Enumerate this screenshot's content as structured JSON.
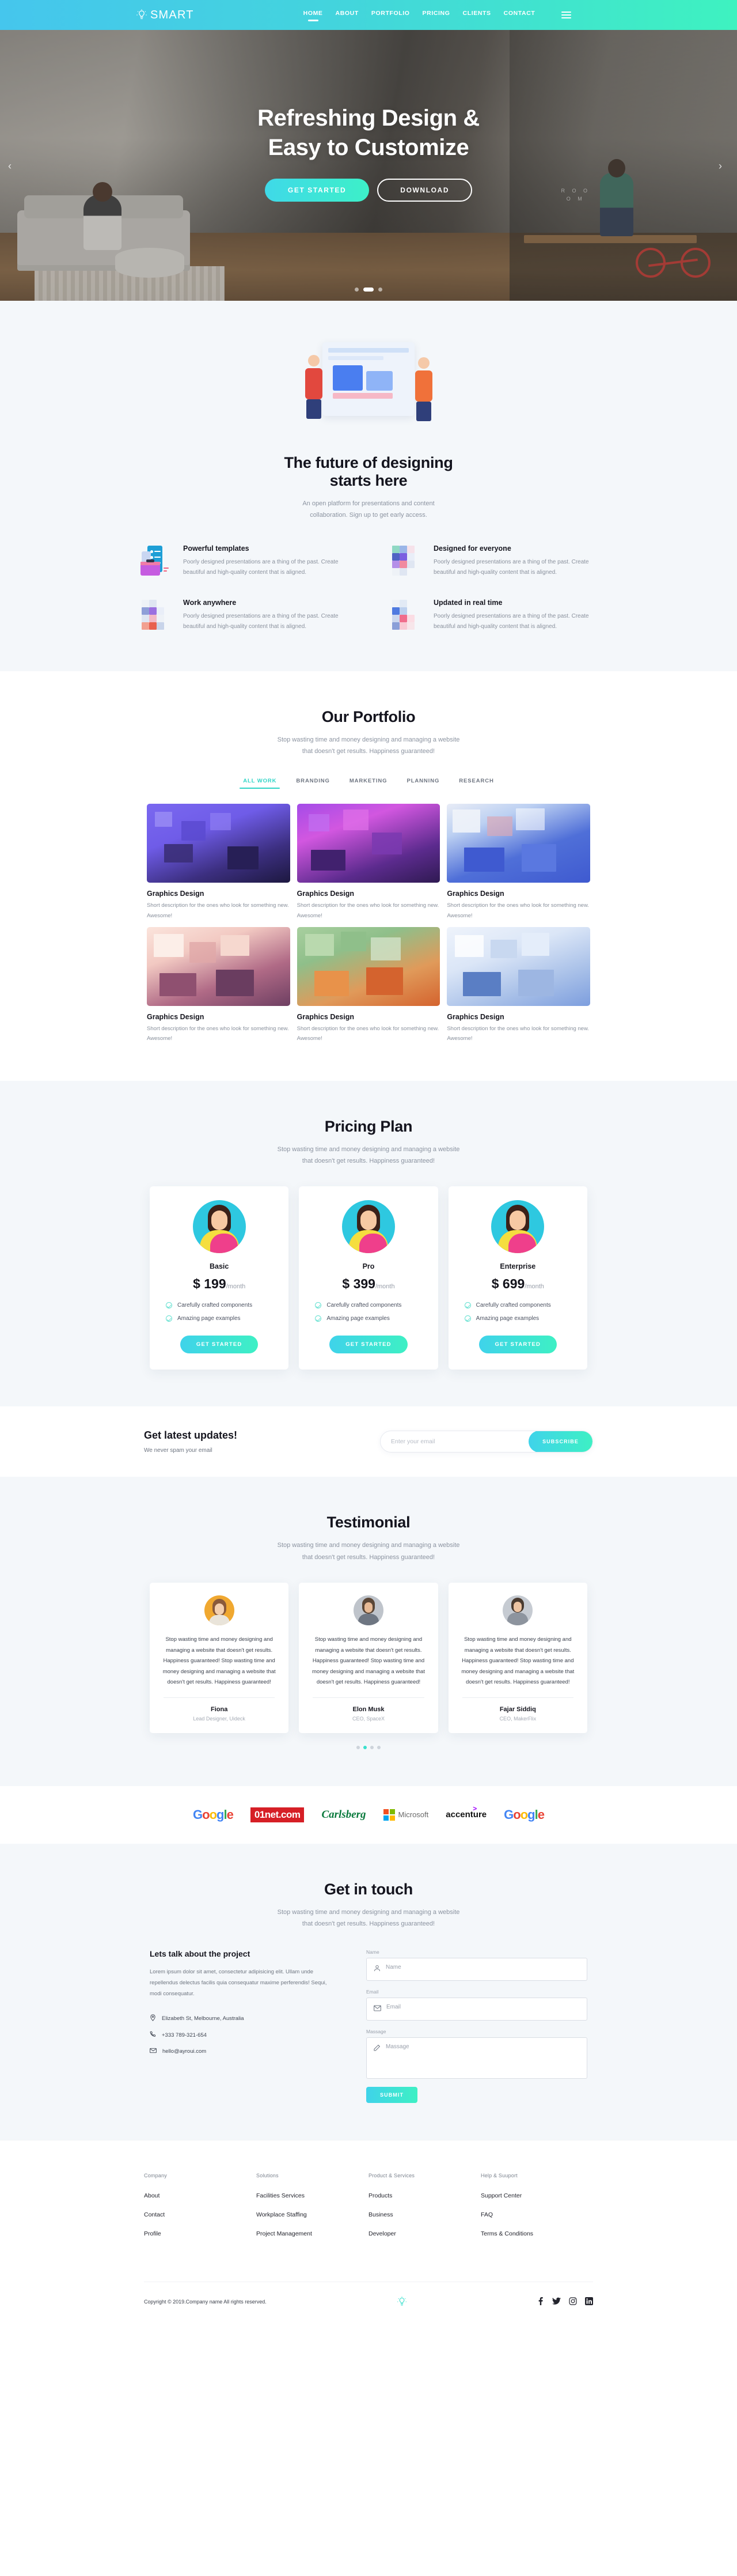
{
  "nav": {
    "brand": "SMART",
    "brand_icon": "lightbulb-icon",
    "items": [
      {
        "label": "HOME",
        "active": true
      },
      {
        "label": "ABOUT",
        "active": false
      },
      {
        "label": "PORTFOLIO",
        "active": false
      },
      {
        "label": "PRICING",
        "active": false
      },
      {
        "label": "CLIENTS",
        "active": false
      },
      {
        "label": "CONTACT",
        "active": false
      }
    ],
    "menu_icon": "hamburger-menu-icon"
  },
  "hero": {
    "title_line1": "Refreshing Design &",
    "title_line2": "Easy to Customize",
    "primary_button": "GET STARTED",
    "secondary_button": "DOWNLOAD",
    "room_label_line1": "R  O  O",
    "room_label_line2": "O     M",
    "slider_dots": 3,
    "active_dot": 1
  },
  "future": {
    "title_line1": "The future of designing",
    "title_line2": "starts here",
    "subtitle_line1": "An open platform for presentations and content",
    "subtitle_line2": "collaboration. Sign up to get early access.",
    "features": [
      {
        "title": "Powerful templates",
        "desc": "Poorly designed presentations are a thing of the past. Create beautiful and high-quality content that is aligned.",
        "icon": "document-briefcase-icon"
      },
      {
        "title": "Designed for everyone",
        "desc": "Poorly designed presentations are a thing of the past. Create beautiful and high-quality content that is aligned.",
        "icon": "pixel-blocks-icon"
      },
      {
        "title": "Work anywhere",
        "desc": "Poorly designed presentations are a thing of the past. Create beautiful and high-quality content that is aligned.",
        "icon": "pixel-blocks-icon"
      },
      {
        "title": "Updated in real time",
        "desc": "Poorly designed presentations are a thing of the past. Create beautiful and high-quality content that is aligned.",
        "icon": "pixel-blocks-icon"
      }
    ]
  },
  "portfolio": {
    "title": "Our Portfolio",
    "subtitle_line1": "Stop wasting time and money designing and managing a website",
    "subtitle_line2": "that doesn't get results. Happiness guaranteed!",
    "tabs": [
      {
        "label": "ALL WORK",
        "active": true
      },
      {
        "label": "BRANDING",
        "active": false
      },
      {
        "label": "MARKETING",
        "active": false
      },
      {
        "label": "PLANNING",
        "active": false
      },
      {
        "label": "RESEARCH",
        "active": false
      }
    ],
    "items": [
      {
        "name": "Graphics Design",
        "desc": "Short description for the ones who look for something new. Awesome!",
        "color_a": "#6d5de8",
        "color_b": "#2b2152"
      },
      {
        "name": "Graphics Design",
        "desc": "Short description for the ones who look for something new. Awesome!",
        "color_a": "#c44ce8",
        "color_b": "#3a1f6e"
      },
      {
        "name": "Graphics Design",
        "desc": "Short description for the ones who look for something new. Awesome!",
        "color_a": "#3f6ae0",
        "color_b": "#8fa8e8"
      },
      {
        "name": "Graphics Design",
        "desc": "Short description for the ones who look for something new. Awesome!",
        "color_a": "#f2cfc6",
        "color_b": "#8b4a6e"
      },
      {
        "name": "Graphics Design",
        "desc": "Short description for the ones who look for something new. Awesome!",
        "color_a": "#8fbf8a",
        "color_b": "#e07a3a"
      },
      {
        "name": "Graphics Design",
        "desc": "Short description for the ones who look for something new. Awesome!",
        "color_a": "#cfe0f7",
        "color_b": "#5a7ec4"
      }
    ]
  },
  "pricing": {
    "title": "Pricing Plan",
    "subtitle_line1": "Stop wasting time and money designing and managing a website",
    "subtitle_line2": "that doesn't get results. Happiness guaranteed!",
    "plans": [
      {
        "name": "Basic",
        "price": "$ 199",
        "period": "/month",
        "features": [
          "Carefully crafted components",
          "Amazing page examples"
        ],
        "button": "GET STARTED"
      },
      {
        "name": "Pro",
        "price": "$ 399",
        "period": "/month",
        "features": [
          "Carefully crafted components",
          "Amazing page examples"
        ],
        "button": "GET STARTED"
      },
      {
        "name": "Enterprise",
        "price": "$ 699",
        "period": "/month",
        "features": [
          "Carefully crafted components",
          "Amazing page examples"
        ],
        "button": "GET STARTED"
      }
    ]
  },
  "newsletter": {
    "title": "Get latest updates!",
    "note": "We never spam your email",
    "placeholder": "Enter your email",
    "value": "",
    "button": "SUBSCRIBE"
  },
  "testimonial": {
    "title": "Testimonial",
    "subtitle_line1": "Stop wasting time and money designing and managing a website",
    "subtitle_line2": "that doesn't get results. Happiness guaranteed!",
    "items": [
      {
        "text": "Stop wasting time and money designing and managing a website that doesn't get results. Happiness guaranteed! Stop wasting time and money designing and managing a website that doesn't get results. Happiness guaranteed!",
        "name": "Fiona",
        "role": "Lead Designer, Uideck"
      },
      {
        "text": "Stop wasting time and money designing and managing a website that doesn't get results. Happiness guaranteed! Stop wasting time and money designing and managing a website that doesn't get results. Happiness guaranteed!",
        "name": "Elon Musk",
        "role": "CEO, SpaceX"
      },
      {
        "text": "Stop wasting time and money designing and managing a website that doesn't get results. Happiness guaranteed! Stop wasting time and money designing and managing a website that doesn't get results. Happiness guaranteed!",
        "name": "Fajar Siddiq",
        "role": "CEO, MakerFlix"
      }
    ],
    "dots": 4,
    "active_dot": 1
  },
  "clients": {
    "logos": [
      "Google",
      "01net.com",
      "Carlsberg",
      "Microsoft",
      "accenture",
      "Google"
    ]
  },
  "contact": {
    "title": "Get in touch",
    "subtitle_line1": "Stop wasting time and money designing and managing a website",
    "subtitle_line2": "that doesn't get results. Happiness guaranteed!",
    "heading": "Lets talk about the project",
    "paragraph": "Lorem ipsum dolor sit amet, consectetur adipisicing elit. Ullam unde repellendus delectus facilis quia consequatur maxime perferendis! Sequi, modi consequatur.",
    "address": "Elizabeth St, Melbourne, Australia",
    "phone": "+333 789-321-654",
    "email": "hello@ayroui.com",
    "address_icon": "map-pin-icon",
    "phone_icon": "phone-icon",
    "email_icon": "envelope-icon",
    "fields": [
      {
        "label": "Name",
        "placeholder": "Name",
        "value": "",
        "icon": "user-icon"
      },
      {
        "label": "Email",
        "placeholder": "Email",
        "value": "",
        "icon": "envelope-icon"
      },
      {
        "label": "Massage",
        "placeholder": "Massage",
        "value": "",
        "icon": "pencil-icon"
      }
    ],
    "submit_button": "SUBMIT"
  },
  "footer": {
    "columns": [
      {
        "heading": "Company",
        "links": [
          "About",
          "Contact",
          "Profile"
        ]
      },
      {
        "heading": "Solutions",
        "links": [
          "Facilities Services",
          "Workplace Staffing",
          "Project Management"
        ]
      },
      {
        "heading": "Product & Services",
        "links": [
          "Products",
          "Business",
          "Developer"
        ]
      },
      {
        "heading": "Help & Suuport",
        "links": [
          "Support Center",
          "FAQ",
          "Terms & Conditions"
        ]
      }
    ],
    "copyright": "Copyright © 2019.Company name All rights reserved.",
    "logo_icon": "lightbulb-icon",
    "socials": [
      {
        "name": "facebook-icon",
        "glyph": "f"
      },
      {
        "name": "twitter-icon",
        "glyph": "🐦"
      },
      {
        "name": "instagram-icon",
        "glyph": "▣"
      },
      {
        "name": "linkedin-icon",
        "glyph": "in"
      }
    ]
  },
  "colors": {
    "accent_start": "#3fd3ea",
    "accent_end": "#3ef0c4",
    "teal": "#2fd4c6",
    "dark": "#15151e",
    "muted": "#8a919d",
    "bg_gray": "#f4f7fa"
  }
}
